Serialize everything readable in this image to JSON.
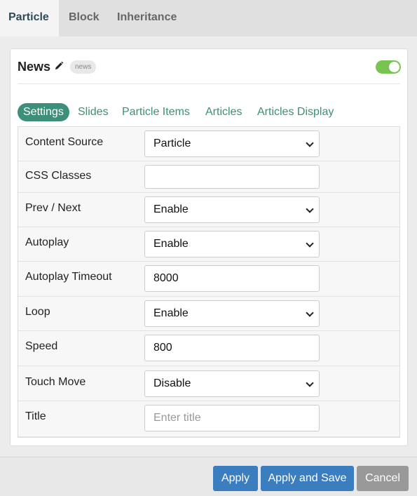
{
  "tabs": {
    "particle": "Particle",
    "block": "Block",
    "inheritance": "Inheritance"
  },
  "particle": {
    "title": "News",
    "tag": "news",
    "enabled": true
  },
  "subtabs": [
    "Settings",
    "Slides",
    "Particle Items",
    "Articles",
    "Articles Display"
  ],
  "fields": [
    {
      "label": "Content Source",
      "value": "Particle"
    },
    {
      "label": "CSS Classes",
      "value": ""
    },
    {
      "label": "Prev / Next",
      "value": "Enable"
    },
    {
      "label": "Autoplay",
      "value": "Enable"
    },
    {
      "label": "Autoplay Timeout",
      "value": "8000"
    },
    {
      "label": "Loop",
      "value": "Enable"
    },
    {
      "label": "Speed",
      "value": "800"
    },
    {
      "label": "Touch Move",
      "value": "Disable"
    },
    {
      "label": "Title",
      "placeholder": "Enter title"
    }
  ],
  "footer": {
    "apply": "Apply",
    "apply_save": "Apply and Save",
    "cancel": "Cancel"
  },
  "colors": {
    "accent": "#3d8f7a",
    "primary_button": "#3b7ec0",
    "toggle_on": "#79c352"
  }
}
